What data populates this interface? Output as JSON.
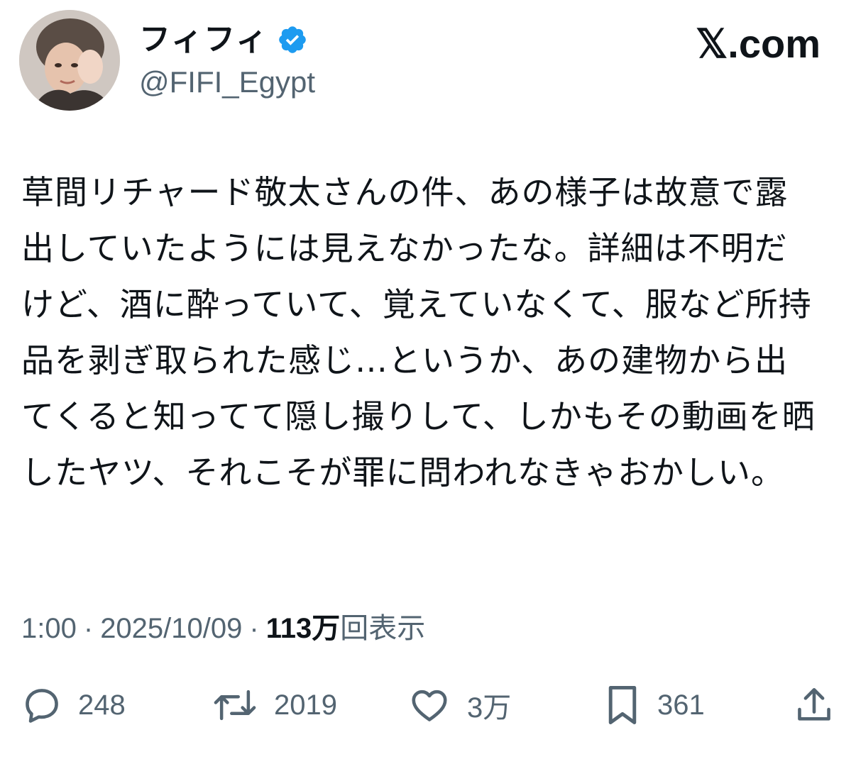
{
  "author": {
    "display_name": "フィフィ",
    "handle": "@FIFI_Egypt",
    "verified": true,
    "avatar": "user-portrait-photo"
  },
  "brand": {
    "label": "𝕏.com"
  },
  "tweet": {
    "text": "草間リチャード敬太さんの件、あの様子は故意で露出していたようには見えなかったな。詳細は不明だけど、酒に酔っていて、覚えていなくて、服など所持品を剥ぎ取られた感じ…というか、あの建物から出てくると知ってて隠し撮りして、しかもその動画を晒したヤツ、それこそが罪に問われなきゃおかしい。"
  },
  "meta": {
    "time": "1:00",
    "separator": "·",
    "date": "2025/10/09",
    "views_count": "113万",
    "views_label": "回表示"
  },
  "actions": {
    "reply_count": "248",
    "retweet_count": "2019",
    "like_count": "3万",
    "bookmark_count": "361"
  },
  "icons": {
    "reply": "speech-bubble-icon",
    "retweet": "retweet-arrows-icon",
    "like": "heart-icon",
    "bookmark": "bookmark-icon",
    "share": "share-upload-icon",
    "verified": "verified-badge-icon"
  },
  "colors": {
    "text": "#0f1419",
    "secondary": "#536471",
    "verified": "#1d9bf0",
    "background": "#ffffff"
  }
}
